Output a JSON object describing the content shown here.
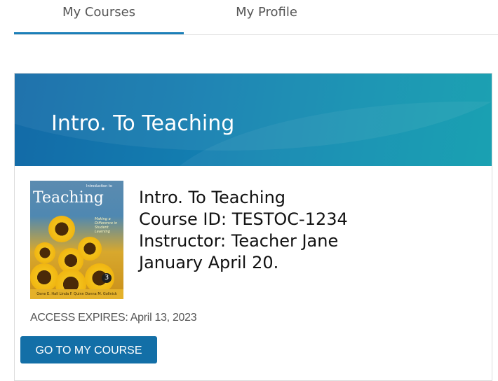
{
  "nav": {
    "tabs": [
      {
        "label": "My Courses",
        "active": true
      },
      {
        "label": "My Profile",
        "active": false
      }
    ]
  },
  "course": {
    "banner_title": "Intro. To Teaching",
    "name": "Intro. To Teaching",
    "course_id": "Course ID: TESTOC-1234",
    "instructor": "Instructor: Teacher Jane",
    "dates": "January April 20.",
    "access_expires": "ACCESS EXPIRES: April 13, 2023",
    "button_label": "GO TO MY COURSE",
    "cover": {
      "intro_text": "Introduction to",
      "title": "Teaching",
      "subtitle": "Making a Difference in Student Learning",
      "edition": "3",
      "authors": "Gene E. Hall  Linda F. Quinn  Donna M. Gollnick"
    }
  },
  "colors": {
    "accent": "#1b7fb8",
    "banner": "#137eb0",
    "button": "#136fa7"
  }
}
